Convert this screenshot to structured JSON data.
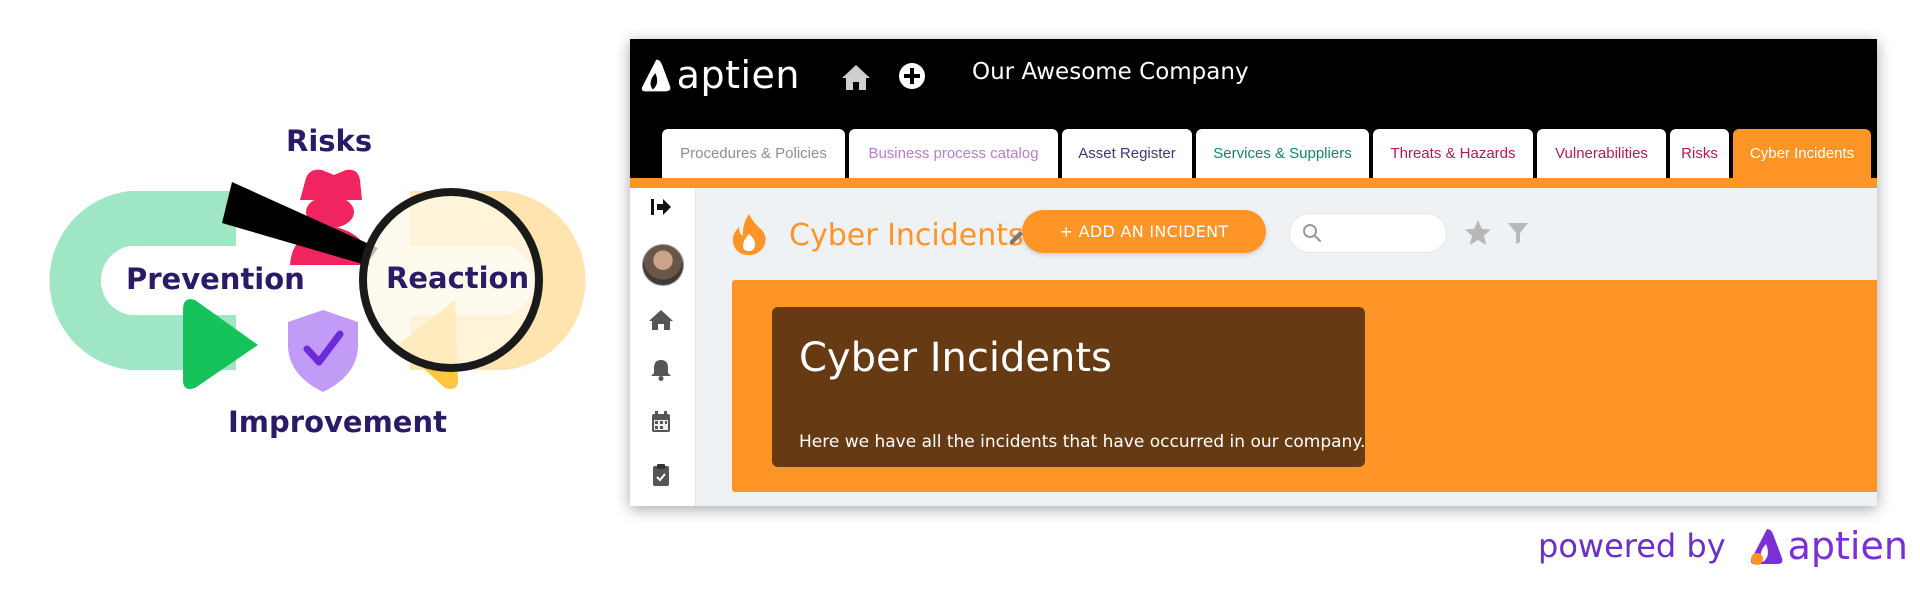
{
  "illustration": {
    "labels": {
      "risks": "Risks",
      "prevention": "Prevention",
      "reaction": "Reaction",
      "improvement": "Improvement"
    },
    "colors": {
      "text": "#2b1a66",
      "mint": "#9fe6c4",
      "peach": "#ffe4b0",
      "green": "#16c35a",
      "pink": "#f0245e",
      "purple": "#c19bf6",
      "check": "#6c2bd9"
    }
  },
  "app": {
    "logo_text": "aptien",
    "company_name": "Our Awesome Company",
    "tabs": [
      {
        "label": "Procedures & Policies",
        "color": "#8a8f96"
      },
      {
        "label": "Business process catalog",
        "color": "#b77fc7"
      },
      {
        "label": "Asset Register",
        "color": "#3a3a7a"
      },
      {
        "label": "Services & Suppliers",
        "color": "#15846a"
      },
      {
        "label": "Threats & Hazards",
        "color": "#b01c50"
      },
      {
        "label": "Vulnerabilities",
        "color": "#b01c50"
      },
      {
        "label": "Risks",
        "color": "#b01c50"
      },
      {
        "label": "Cyber Incidents",
        "color": "#ffffff",
        "active": true
      }
    ],
    "sidebar_icons": [
      "collapse-arrow-icon",
      "avatar",
      "home-icon",
      "bell-icon",
      "calendar-icon",
      "clipboard-icon"
    ],
    "page": {
      "icon": "flame-icon",
      "title": "Cyber Incidents",
      "add_button": "+ ADD AN INCIDENT",
      "search_placeholder": "",
      "banner_title": "Cyber Incidents",
      "banner_description": "Here we have all the incidents that have occurred in our company."
    },
    "accent_color": "#ff9427"
  },
  "footer": {
    "powered_by": "powered by",
    "brand": "aptien"
  }
}
